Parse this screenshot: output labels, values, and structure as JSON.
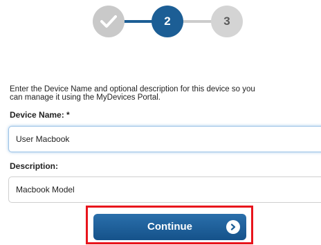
{
  "stepper": {
    "step1": {
      "state": "complete",
      "icon": "check-icon"
    },
    "step2": {
      "label": "2",
      "state": "current"
    },
    "step3": {
      "label": "3",
      "state": "upcoming"
    }
  },
  "instructions": {
    "line1": "Enter the Device Name and optional description for this device so you",
    "line2": "can manage it using the MyDevices Portal."
  },
  "device_name": {
    "label": "Device Name: *",
    "value": "User Macbook"
  },
  "description": {
    "label": "Description:",
    "value": "Macbook Model"
  },
  "continue": {
    "label": "Continue",
    "icon": "chevron-right-icon"
  },
  "colors": {
    "primary": "#1c5e95",
    "complete_step": "#c9c9c9",
    "upcoming_step": "#d4d4d4",
    "highlight": "#e8141c"
  }
}
